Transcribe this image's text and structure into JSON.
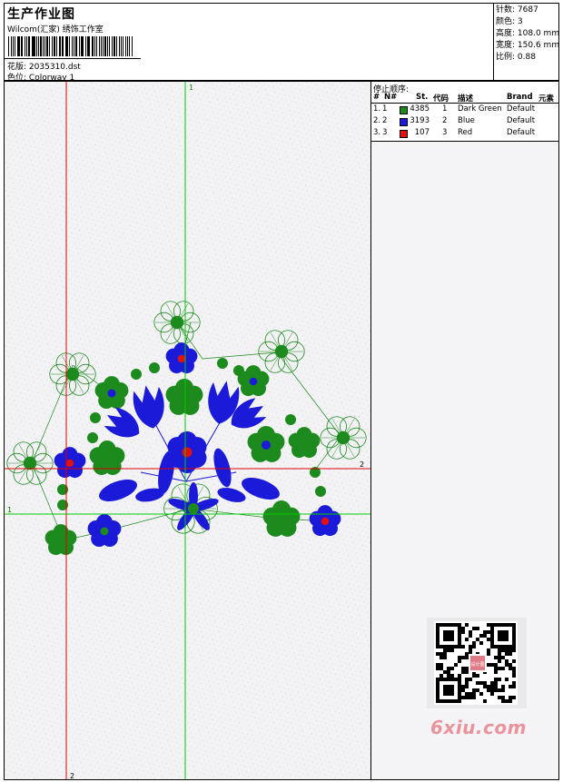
{
  "header": {
    "title": "生产作业图",
    "company": "Wilcom(汇家) 绣饰工作室",
    "pattern_label": "花版:",
    "pattern_value": "2035310.dst",
    "colorway_label": "色位:",
    "colorway_value": "Colorway 1"
  },
  "stats": [
    {
      "label": "针数:",
      "value": "7687"
    },
    {
      "label": "颜色:",
      "value": "3"
    },
    {
      "label": "高度:",
      "value": "108.0 mm"
    },
    {
      "label": "宽度:",
      "value": "150.6 mm"
    },
    {
      "label": "比例:",
      "value": "0.88"
    }
  ],
  "stop_table": {
    "title": "停止顺序:",
    "headers": [
      "#",
      "N#",
      "St.",
      "代码",
      "描述",
      "Brand",
      "元素"
    ],
    "rows": [
      {
        "idx": "1.",
        "n": "1",
        "color": "#1c8a1c",
        "st": "4385",
        "code": "1",
        "desc": "Dark Green",
        "brand": "Default"
      },
      {
        "idx": "2.",
        "n": "2",
        "color": "#1a1ad8",
        "st": "3193",
        "code": "2",
        "desc": "Blue",
        "brand": "Default"
      },
      {
        "idx": "3.",
        "n": "3",
        "color": "#e01010",
        "st": "107",
        "code": "3",
        "desc": "Red",
        "brand": "Default"
      }
    ]
  },
  "guides": {
    "v_green_label": "1",
    "h_green_label": "1",
    "h_red_label": "2",
    "v_red_label": "2"
  },
  "colors": {
    "green": "#1c8a1c",
    "blue": "#1a1ad8",
    "red": "#e01010",
    "guide_red": "#e00000",
    "guide_green": "#00cc00"
  },
  "watermark": "6xiu.com",
  "qr_badge": "设计图"
}
